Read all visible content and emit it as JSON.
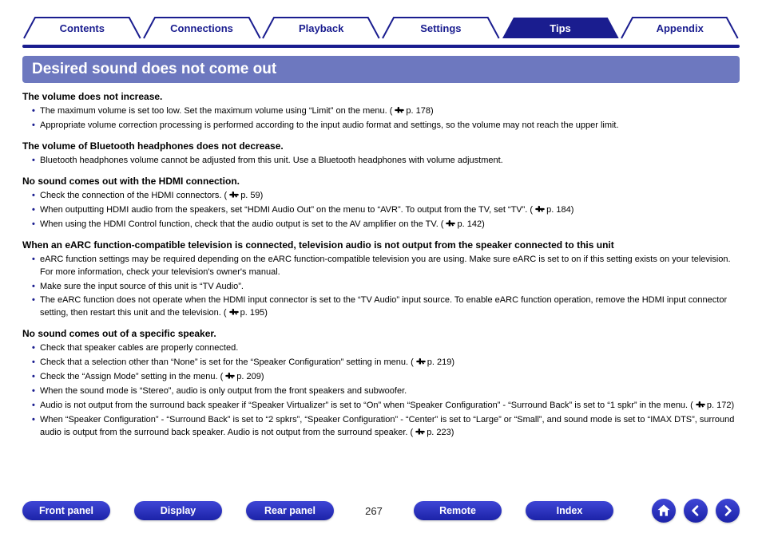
{
  "tabs": [
    {
      "label": "Contents",
      "active": false
    },
    {
      "label": "Connections",
      "active": false
    },
    {
      "label": "Playback",
      "active": false
    },
    {
      "label": "Settings",
      "active": false
    },
    {
      "label": "Tips",
      "active": true
    },
    {
      "label": "Appendix",
      "active": false
    }
  ],
  "section_title": "Desired sound does not come out",
  "groups": [
    {
      "title": "The volume does not increase.",
      "items": [
        {
          "text": "The maximum volume is set too low. Set the maximum volume using “Limit” on the menu.",
          "page": "p. 178"
        },
        {
          "text": "Appropriate volume correction processing is performed according to the input audio format and settings, so the volume may not reach the upper limit."
        }
      ]
    },
    {
      "title": "The volume of Bluetooth headphones does not decrease.",
      "items": [
        {
          "text": "Bluetooth headphones volume cannot be adjusted from this unit. Use a Bluetooth headphones with volume adjustment."
        }
      ]
    },
    {
      "title": "No sound comes out with the HDMI connection.",
      "items": [
        {
          "text": "Check the connection of the HDMI connectors.",
          "page": "p. 59"
        },
        {
          "text": "When outputting HDMI audio from the speakers, set “HDMI Audio Out” on the menu to “AVR”. To output from the TV, set “TV”.",
          "page": "p. 184"
        },
        {
          "text": "When using the HDMI Control function, check that the audio output is set to the AV amplifier on the TV.",
          "page": "p. 142"
        }
      ]
    },
    {
      "title": "When an eARC function-compatible television is connected, television audio is not output from the speaker connected to this unit",
      "items": [
        {
          "text": "eARC function settings may be required depending on the eARC function-compatible television you are using. Make sure eARC is set to on if this setting exists on your television. For more information, check your television's owner's manual."
        },
        {
          "text": "Make sure the input source of this unit is “TV Audio”."
        },
        {
          "text": "The eARC function does not operate when the HDMI input connector is set to the “TV Audio” input source. To enable eARC function operation, remove the HDMI input connector setting, then restart this unit and the television.",
          "page": "p. 195"
        }
      ]
    },
    {
      "title": "No sound comes out of a specific speaker.",
      "items": [
        {
          "text": "Check that speaker cables are properly connected."
        },
        {
          "text": "Check that a selection other than “None” is set for the “Speaker Configuration” setting in menu.",
          "page": "p. 219"
        },
        {
          "text": "Check the “Assign Mode” setting in the menu.",
          "page": "p. 209"
        },
        {
          "text": "When the sound mode is “Stereo”, audio is only output from the front speakers and subwoofer."
        },
        {
          "text": "Audio is not output from the surround back speaker if “Speaker Virtualizer” is set to “On” when “Speaker Configuration” - “Surround Back” is set to “1 spkr” in the menu.",
          "page": "p. 172"
        },
        {
          "text": "When “Speaker Configuration” - “Surround Back” is set to “2 spkrs”, “Speaker Configuration” - “Center” is set to “Large” or “Small”, and sound mode is set to “IMAX DTS”, surround audio is output from the surround back speaker. Audio is not output from the surround speaker.",
          "page": "p. 223"
        }
      ]
    }
  ],
  "bottom_buttons": [
    "Front panel",
    "Display",
    "Rear panel",
    "Remote",
    "Index"
  ],
  "page_number": "267",
  "icons": {
    "home": "home-icon",
    "prev": "arrow-left-icon",
    "next": "arrow-right-icon",
    "pageref": "hand-pointing-icon"
  },
  "colors": {
    "brand": "#1a1d8f",
    "banner": "#6d78bf",
    "pill_top": "#3f46d6",
    "pill_bottom": "#1c23a8"
  }
}
